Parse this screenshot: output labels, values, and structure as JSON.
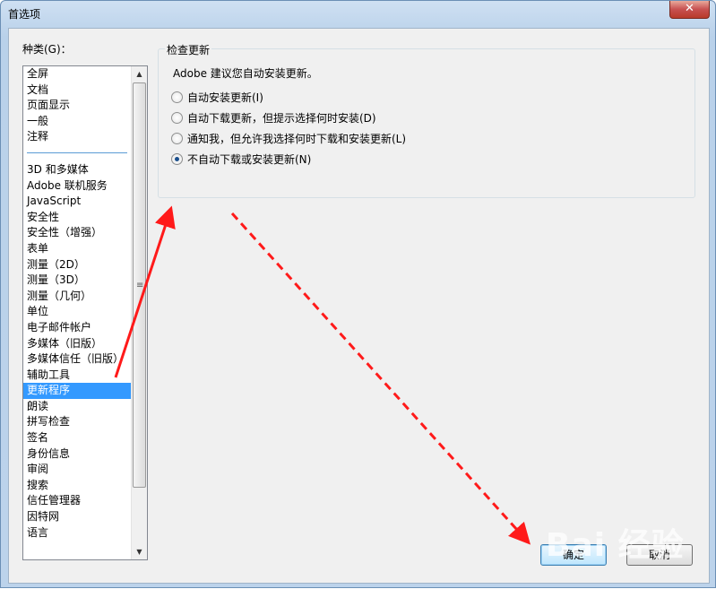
{
  "window": {
    "title": "首选项",
    "close_glyph": "✕"
  },
  "categories": {
    "label": "种类(G)：",
    "top_items": [
      "全屏",
      "文档",
      "页面显示",
      "一般",
      "注释"
    ],
    "items": [
      "3D 和多媒体",
      "Adobe 联机服务",
      "JavaScript",
      "安全性",
      "安全性（增强）",
      "表单",
      "测量（2D）",
      "测量（3D）",
      "测量（几何）",
      "单位",
      "电子邮件帐户",
      "多媒体（旧版）",
      "多媒体信任（旧版）",
      "辅助工具",
      "更新程序",
      "朗读",
      "拼写检查",
      "签名",
      "身份信息",
      "审阅",
      "搜索",
      "信任管理器",
      "因特网",
      "语言"
    ],
    "selected": "更新程序"
  },
  "update_group": {
    "title": "检查更新",
    "intro": "Adobe 建议您自动安装更新。",
    "options": [
      {
        "label": "自动安装更新(I)",
        "checked": false
      },
      {
        "label": "自动下载更新，但提示选择何时安装(D)",
        "checked": false
      },
      {
        "label": "通知我，但允许我选择何时下载和安装更新(L)",
        "checked": false
      },
      {
        "label": "不自动下载或安装更新(N)",
        "checked": true
      }
    ]
  },
  "buttons": {
    "ok": "确定",
    "cancel": "取消"
  },
  "annotation": {
    "arrow_color": "#ff1a1a",
    "watermark": "Bai 经验"
  }
}
